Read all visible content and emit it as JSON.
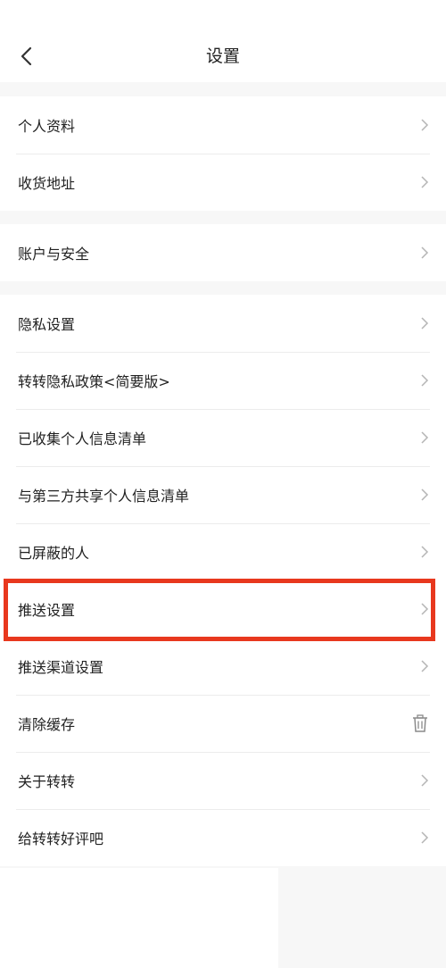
{
  "header": {
    "title": "设置"
  },
  "groups": [
    {
      "items": [
        {
          "label": "个人资料",
          "icon": "chevron-right-icon"
        },
        {
          "label": "收货地址",
          "icon": "chevron-right-icon"
        }
      ]
    },
    {
      "items": [
        {
          "label": "账户与安全",
          "icon": "chevron-right-icon"
        }
      ]
    },
    {
      "items": [
        {
          "label": "隐私设置",
          "icon": "chevron-right-icon"
        },
        {
          "label": "转转隐私政策<简要版>",
          "icon": "chevron-right-icon"
        },
        {
          "label": "已收集个人信息清单",
          "icon": "chevron-right-icon"
        },
        {
          "label": "与第三方共享个人信息清单",
          "icon": "chevron-right-icon"
        },
        {
          "label": "已屏蔽的人",
          "icon": "chevron-right-icon"
        },
        {
          "label": "推送设置",
          "icon": "chevron-right-icon"
        },
        {
          "label": "推送渠道设置",
          "icon": "chevron-right-icon"
        },
        {
          "label": "清除缓存",
          "icon": "trash-icon"
        },
        {
          "label": "关于转转",
          "icon": "chevron-right-icon"
        },
        {
          "label": "给转转好评吧",
          "icon": "chevron-right-icon"
        }
      ]
    }
  ],
  "colors": {
    "highlight": "#e8381e",
    "background": "#f7f7f7",
    "divider": "#ececec"
  }
}
